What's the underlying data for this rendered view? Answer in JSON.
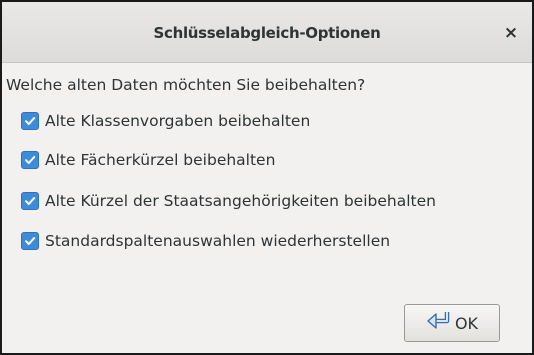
{
  "dialog": {
    "title": "Schlüsselabgleich-Optionen",
    "close_label": "×",
    "question": "Welche alten Daten möchten Sie beibehalten?",
    "options": [
      {
        "label": "Alte Klassenvorgaben beibehalten",
        "checked": true
      },
      {
        "label": "Alte Fächerkürzel beibehalten",
        "checked": true
      },
      {
        "label": "Alte Kürzel der Staatsangehörigkeiten beibehalten",
        "checked": true
      },
      {
        "label": "Standardspaltenauswahlen wiederherstellen",
        "checked": true
      }
    ],
    "ok_label": "OK",
    "ok_icon": "enter-arrow-icon",
    "accent_color": "#3d8bd9"
  }
}
